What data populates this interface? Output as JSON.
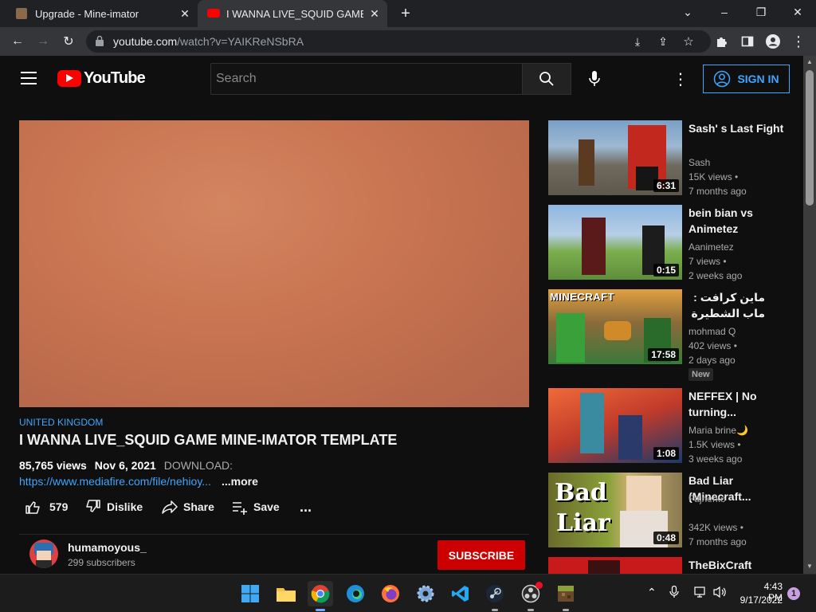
{
  "browser": {
    "tabs": [
      {
        "title": "Upgrade - Mine-imator"
      },
      {
        "title": "I WANNA LIVE_SQUID GAME MINE"
      }
    ],
    "url_host": "youtube.com",
    "url_path": "/watch?v=YAIKReNSbRA"
  },
  "youtube": {
    "logo_text": "YouTube",
    "search_placeholder": "Search",
    "signin_label": "SIGN IN",
    "video": {
      "location_tag": "UNITED KINGDOM",
      "title": "I WANNA LIVE_SQUID GAME MINE-IMATOR TEMPLATE",
      "views": "85,765 views",
      "date": "Nov 6, 2021",
      "desc_prefix": "DOWNLOAD:",
      "desc_link": "https://www.mediafire.com/file/nehioy...",
      "more_label": "...more",
      "likes": "579",
      "dislike_label": "Dislike",
      "share_label": "Share",
      "save_label": "Save",
      "more_actions": "..."
    },
    "channel": {
      "name": "humamoyous_",
      "subscribers": "299 subscribers",
      "subscribe_label": "SUBSCRIBE"
    },
    "suggestions": [
      {
        "title": "Sash' s Last Fight",
        "channel": "Sash",
        "views": "15K views",
        "age": "7 months ago",
        "duration": "6:31"
      },
      {
        "title": "bein bian vs Animetez",
        "channel": "Aanimetez",
        "views": "7 views",
        "age": "2 weeks ago",
        "duration": "0:15"
      },
      {
        "title": "ماين كرافت : ماب الشطيرة (المواجهة...",
        "channel": "mohmad Q",
        "views": "402 views",
        "age": "2 days ago",
        "duration": "17:58",
        "badge": "New",
        "thumb_text": "MINECRAFT"
      },
      {
        "title": "NEFFEX | No turning...",
        "channel": "Maria brine🌙",
        "views": "1.5K views",
        "age": "3 weeks ago",
        "duration": "1:08"
      },
      {
        "title": "Bad Liar (Minecraft...",
        "channel": "Fajnerko",
        "views": "342K views",
        "age": "7 months ago",
        "duration": "0:48",
        "thumb_text_1": "Bad",
        "thumb_text_2": "Liar"
      },
      {
        "title": "TheBixCraft"
      }
    ]
  },
  "taskbar": {
    "time": "4:43 PM",
    "date": "9/17/2022",
    "notification_count": "1"
  },
  "colors": {
    "youtube_red": "#ff0000",
    "link_blue": "#3ea6ff",
    "subscribe_red": "#cc0000"
  }
}
